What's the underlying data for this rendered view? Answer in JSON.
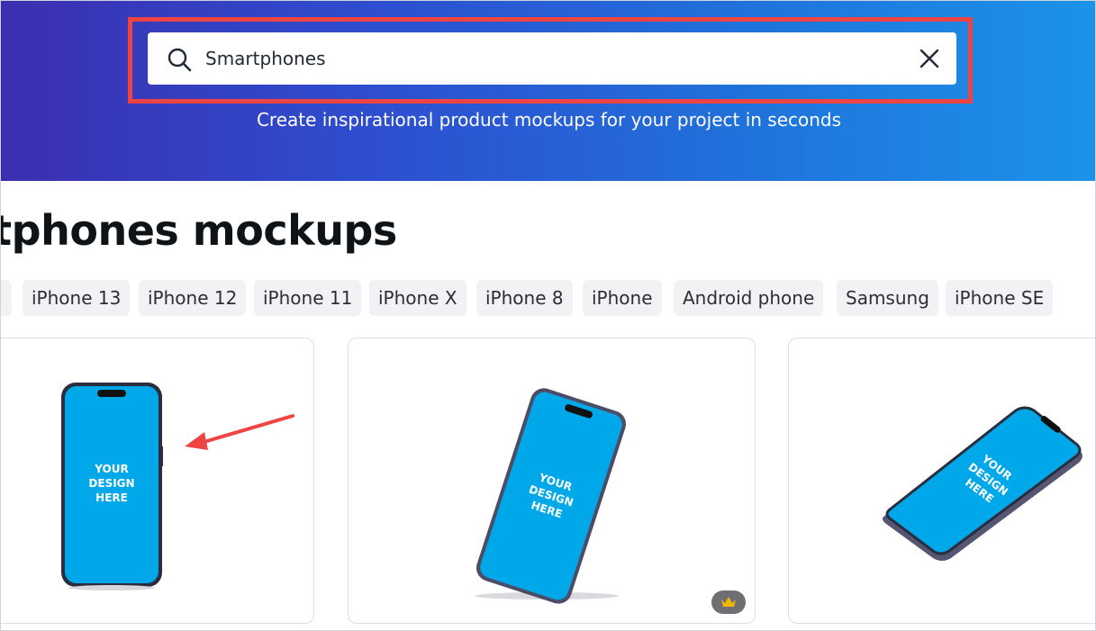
{
  "search": {
    "value": "Smartphones"
  },
  "hero": {
    "tagline": "Create inspirational product mockups for your project in seconds"
  },
  "main": {
    "title": "rtphones mockups"
  },
  "chips": [
    {
      "label": "iPhone 13"
    },
    {
      "label": "iPhone 12"
    },
    {
      "label": "iPhone 11"
    },
    {
      "label": "iPhone X"
    },
    {
      "label": "iPhone 8"
    },
    {
      "label": "iPhone"
    },
    {
      "label": "Android phone"
    },
    {
      "label": "Samsung"
    },
    {
      "label": "iPhone SE"
    }
  ],
  "cards": [
    {
      "screen_text": [
        "YOUR",
        "DESIGN",
        "HERE"
      ]
    },
    {
      "screen_text": [
        "YOUR",
        "DESIGN",
        "HERE"
      ],
      "badge": "crown-icon"
    },
    {
      "screen_text": [
        "YOUR",
        "DESIGN",
        "HERE"
      ]
    }
  ],
  "colors": {
    "highlight": "#ef4444",
    "screen": "#00a8ea",
    "hero_start": "#3b2fb0",
    "hero_end": "#1c93e8"
  }
}
